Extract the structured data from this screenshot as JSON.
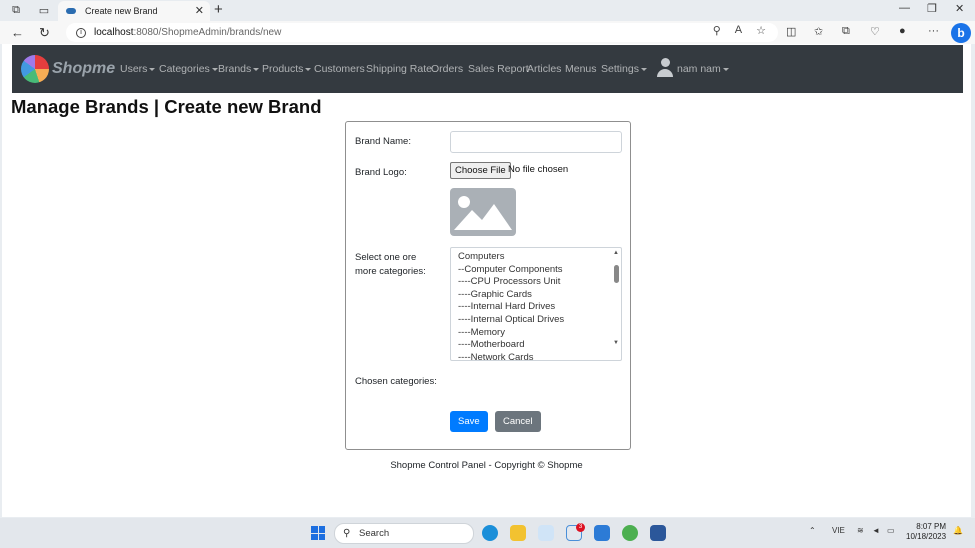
{
  "browser": {
    "tab_title": "Create new Brand",
    "url_host": "localhost",
    "url_path": ":8080/ShopmeAdmin/brands/new"
  },
  "navbar": {
    "brand": "Shopme",
    "items": [
      {
        "label": "Users",
        "dropdown": true
      },
      {
        "label": "Categories",
        "dropdown": true
      },
      {
        "label": "Brands",
        "dropdown": true
      },
      {
        "label": "Products",
        "dropdown": true
      },
      {
        "label": "Customers",
        "dropdown": false
      },
      {
        "label": "Shipping Rate",
        "dropdown": false
      },
      {
        "label": "Orders",
        "dropdown": false
      },
      {
        "label": "Sales Report",
        "dropdown": false
      },
      {
        "label": "Articles",
        "dropdown": false
      },
      {
        "label": "Menus",
        "dropdown": false
      },
      {
        "label": "Settings",
        "dropdown": true
      }
    ],
    "user_name": "nam nam"
  },
  "page": {
    "title": "Manage Brands | Create new Brand"
  },
  "form": {
    "brand_name_label": "Brand Name:",
    "brand_name_value": "",
    "brand_logo_label": "Brand Logo:",
    "choose_file_label": "Choose File",
    "file_status": "No file chosen",
    "categories_label_line1": "Select one ore",
    "categories_label_line2": "more categories:",
    "categories": [
      "Computers",
      "--Computer Components",
      "----CPU Processors Unit",
      "----Graphic Cards",
      "----Internal Hard Drives",
      "----Internal Optical Drives",
      "----Memory",
      "----Motherboard",
      "----Network Cards"
    ],
    "chosen_categories_label": "Chosen categories:",
    "save_label": "Save",
    "cancel_label": "Cancel"
  },
  "footer": {
    "text": "Shopme Control Panel - Copyright © Shopme"
  },
  "taskbar": {
    "search_placeholder": "Search",
    "language": "VIE",
    "time": "8:07 PM",
    "date": "10/18/2023",
    "notification_count": "3"
  }
}
